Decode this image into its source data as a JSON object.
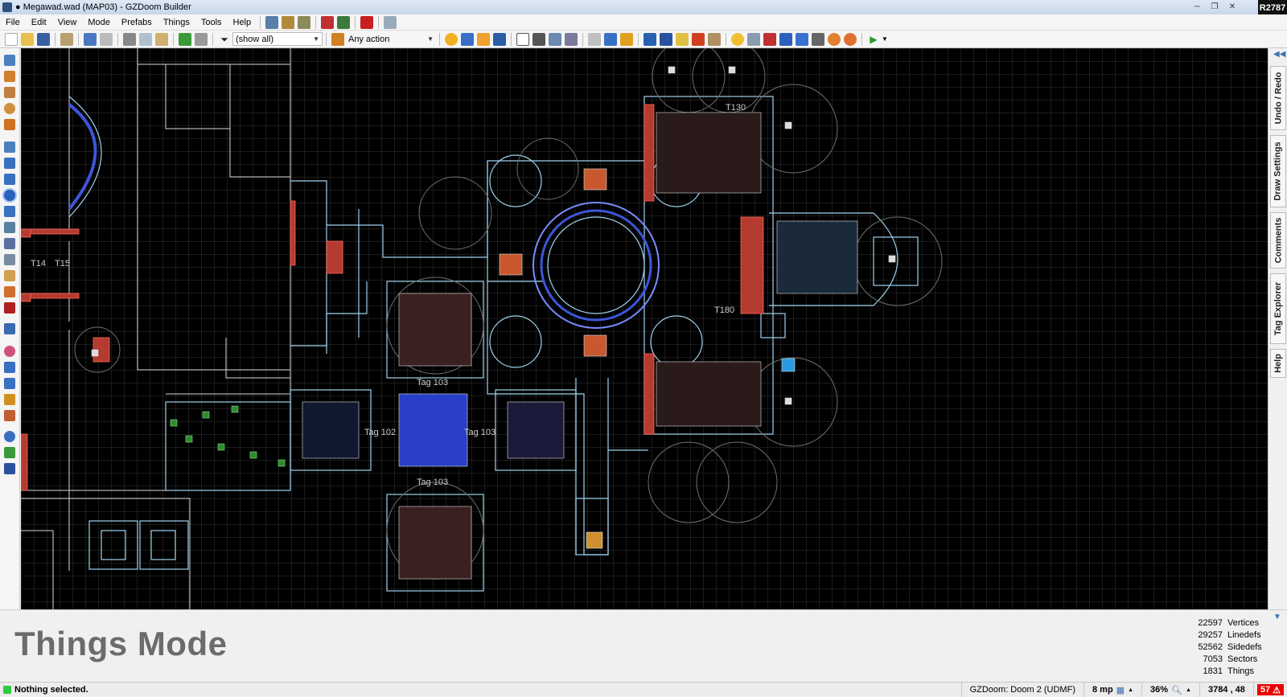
{
  "window": {
    "title": "● Megawad.wad (MAP03) - GZDoom Builder",
    "revision": "R2787",
    "controls": [
      "─",
      "❐",
      "✕"
    ]
  },
  "menu": [
    "File",
    "Edit",
    "View",
    "Mode",
    "Prefabs",
    "Things",
    "Tools",
    "Help"
  ],
  "toolbar": {
    "filter_value": "(show all)",
    "action_value": "Any action"
  },
  "map": {
    "labels": [
      {
        "text": "T14"
      },
      {
        "text": "T15"
      },
      {
        "text": "T130"
      },
      {
        "text": "T180"
      },
      {
        "text": "Tag 103"
      },
      {
        "text": "Tag 102"
      },
      {
        "text": "Tag 103"
      },
      {
        "text": "Tag 103"
      }
    ]
  },
  "right_tabs": [
    "Undo / Redo",
    "Draw Settings",
    "Comments",
    "Tag Explorer",
    "Help"
  ],
  "info": {
    "mode_title": "Things Mode",
    "stats": [
      {
        "value": "22597",
        "label": "Vertices"
      },
      {
        "value": "29257",
        "label": "Linedefs"
      },
      {
        "value": "52562",
        "label": "Sidedefs"
      },
      {
        "value": "7053",
        "label": "Sectors"
      },
      {
        "value": "1831",
        "label": "Things"
      }
    ]
  },
  "status": {
    "message": "Nothing selected.",
    "engine": "GZDoom: Doom 2 (UDMF)",
    "grid": "8 mp",
    "zoom": "36%",
    "coords": "3784 , 48",
    "errors": "57"
  },
  "colors": {
    "line": "#9fd3f0",
    "red": "#d24b3c",
    "blue": "#3d55d8",
    "background": "#000000"
  }
}
